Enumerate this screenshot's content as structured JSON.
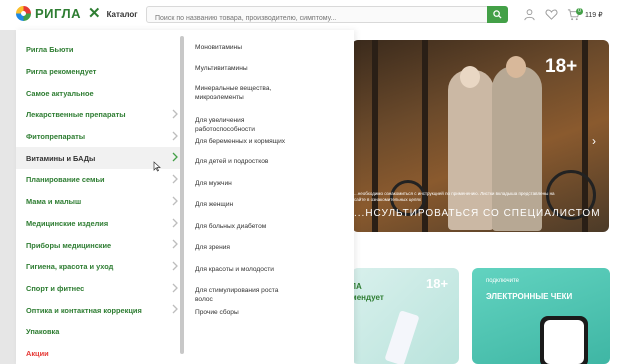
{
  "header": {
    "logo_text": "РИГЛА",
    "catalog_label": "Каталог",
    "search_placeholder": "Поиск по названию товара, производителю, симптому...",
    "cart_count": "0",
    "cart_price": "119 ₽"
  },
  "categories": [
    {
      "label": "Ригла Бьюти",
      "has_chevron": false
    },
    {
      "label": "Ригла рекомендует",
      "has_chevron": false
    },
    {
      "label": "Самое актуальное",
      "has_chevron": false
    },
    {
      "label": "Лекарственные препараты",
      "has_chevron": true
    },
    {
      "label": "Фитопрепараты",
      "has_chevron": true
    },
    {
      "label": "Витамины и БАДы",
      "has_chevron": true,
      "active": true
    },
    {
      "label": "Планирование семьи",
      "has_chevron": true
    },
    {
      "label": "Мама и малыш",
      "has_chevron": true
    },
    {
      "label": "Медицинские изделия",
      "has_chevron": true
    },
    {
      "label": "Приборы медицинские",
      "has_chevron": true
    },
    {
      "label": "Гигиена, красота и уход",
      "has_chevron": true
    },
    {
      "label": "Спорт и фитнес",
      "has_chevron": true
    },
    {
      "label": "Оптика и контактная коррекция",
      "has_chevron": true
    },
    {
      "label": "Упаковка",
      "has_chevron": false
    },
    {
      "label": "Акции",
      "has_chevron": false,
      "red": true
    }
  ],
  "subcategories": [
    "Моновитамины",
    "Мультивитамины",
    "Минеральные вещества, микроэлементы",
    "Для увеличения работоспособности",
    "Для беременных и кормящих",
    "Для детей и подростков",
    "Для мужчин",
    "Для женщин",
    "Для больных диабетом",
    "Для зрения",
    "Для красоты и молодости",
    "Для стимулирования роста волос",
    "Прочие сборы"
  ],
  "banner": {
    "age_label": "18+",
    "disclaimer": "...необходимо ознакомиться с инструкцией по применению. Листки вкладыша представлены на сайте в ознакомительных целях",
    "consult_text": "...НСУЛЬТИРОВАТЬСЯ СО СПЕЦИАЛИСТОМ"
  },
  "promo_left": {
    "title_line1": "ГЛА",
    "title_line2": "омендует",
    "age_label": "18+"
  },
  "promo_right": {
    "subtitle": "подключите",
    "title": "ЭЛЕКТРОННЫЕ ЧЕКИ"
  },
  "colors": {
    "brand_green": "#2e7d32",
    "accent_green": "#43a047",
    "sale_red": "#e53935",
    "active_row_bg": "#f1f1f1"
  }
}
